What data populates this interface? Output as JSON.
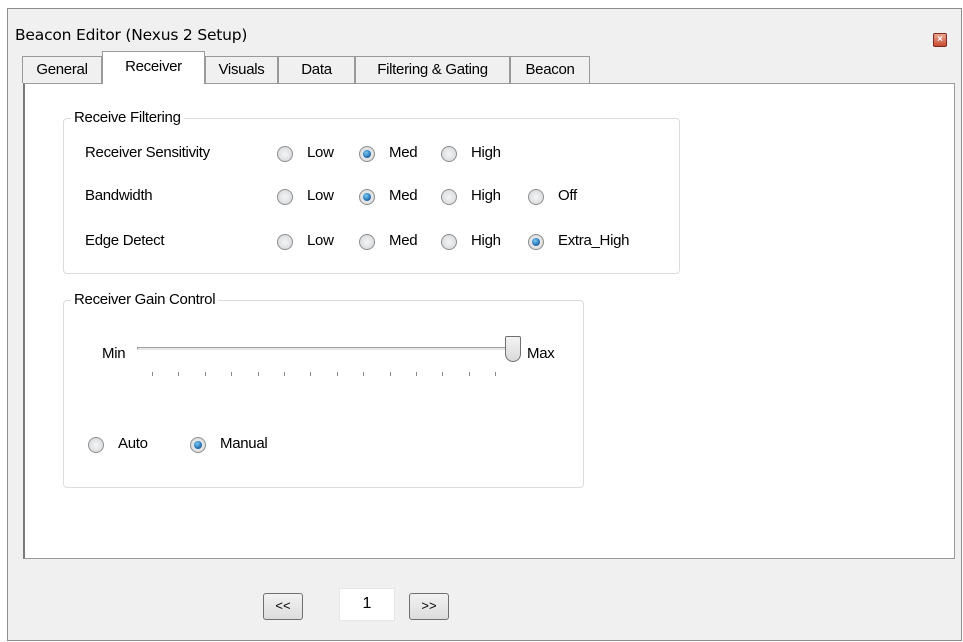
{
  "window": {
    "title": "Beacon Editor (Nexus 2 Setup)",
    "close_symbol": "×"
  },
  "tabs": [
    {
      "label": "General",
      "active": false
    },
    {
      "label": "Receiver",
      "active": true
    },
    {
      "label": "Visuals",
      "active": false
    },
    {
      "label": "Data",
      "active": false
    },
    {
      "label": "Filtering & Gating",
      "active": false
    },
    {
      "label": "Beacon",
      "active": false
    }
  ],
  "receive_filtering": {
    "legend": "Receive Filtering",
    "receiver_sensitivity": {
      "label": "Receiver Sensitivity",
      "options": [
        "Low",
        "Med",
        "High"
      ],
      "selected": "Med"
    },
    "bandwidth": {
      "label": "Bandwidth",
      "options": [
        "Low",
        "Med",
        "High",
        "Off"
      ],
      "selected": "Med"
    },
    "edge_detect": {
      "label": "Edge Detect",
      "options": [
        "Low",
        "Med",
        "High",
        "Extra_High"
      ],
      "selected": "Extra_High"
    }
  },
  "gain_control": {
    "legend": "Receiver Gain Control",
    "min_label": "Min",
    "max_label": "Max",
    "slider_level": 1.0,
    "mode_options": [
      "Auto",
      "Manual"
    ],
    "mode_selected": "Manual"
  },
  "pager": {
    "prev_label": "<<",
    "page": "1",
    "next_label": ">>"
  },
  "colors": {
    "window_bg": "#f0f0f0",
    "panel_bg": "#ffffff",
    "radio_selected": "#2b79b8",
    "close_button": "#c74c32"
  }
}
